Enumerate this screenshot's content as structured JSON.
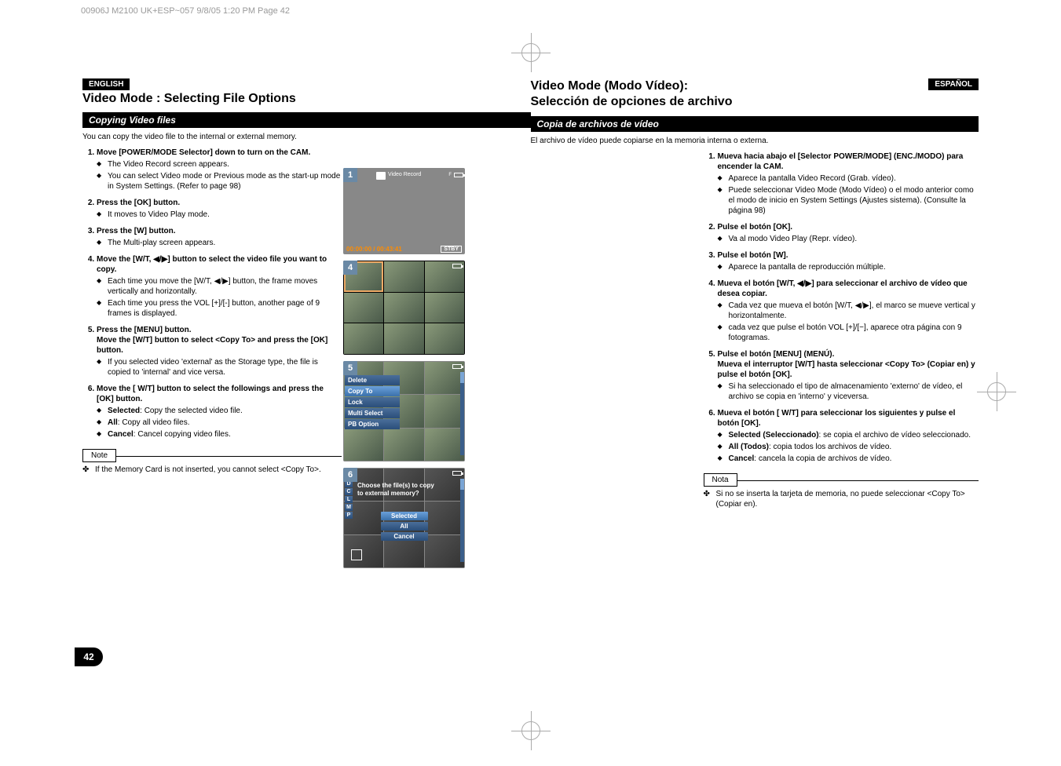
{
  "header_line": "00906J M2100 UK+ESP~057  9/8/05 1:20 PM  Page 42",
  "page_number": "42",
  "left": {
    "lang": "ENGLISH",
    "title": "Video Mode : Selecting File Options",
    "subhead": "Copying Video files",
    "intro": "You can copy the video file to the internal or external memory.",
    "steps": [
      {
        "head": "Move [POWER/MODE Selector] down to turn on the CAM.",
        "bullets": [
          "The Video Record screen appears.",
          "You can select Video mode or Previous mode as the start-up mode in System Settings. (Refer to page 98)"
        ]
      },
      {
        "head": "Press the [OK] button.",
        "bullets": [
          "It moves to Video Play mode."
        ]
      },
      {
        "head": "Press the [W] button.",
        "bullets": [
          "The Multi-play screen appears."
        ]
      },
      {
        "head": "Move the [W/T, ◀/▶] button to select the video file you want to copy.",
        "bullets": [
          "Each time you move the [W/T, ◀/▶] button, the frame moves vertically and horizontally.",
          "Each time you press the VOL [+]/[-] button, another page of 9 frames is displayed."
        ]
      },
      {
        "head": "Press the [MENU] button.\nMove the [W/T] button to select <Copy To> and press the [OK] button.",
        "bullets": [
          "If you selected video 'external' as the Storage type, the file is copied to 'internal' and vice versa."
        ]
      },
      {
        "head": "Move the [ W/T] button to select the followings and press the [OK] button.",
        "bullets_bold": [
          {
            "b": "Selected",
            "t": ": Copy the selected video file."
          },
          {
            "b": "All",
            "t": ": Copy all video files."
          },
          {
            "b": "Cancel",
            "t": ": Cancel copying video files."
          }
        ]
      }
    ],
    "note_label": "Note",
    "note_text": "If the Memory Card is not inserted, you cannot select <Copy To>."
  },
  "right": {
    "lang": "ESPAÑOL",
    "title_l1": "Video Mode (Modo Vídeo):",
    "title_l2": "Selección de opciones de archivo",
    "subhead": "Copia de archivos de vídeo",
    "intro": "El archivo de vídeo puede copiarse en la memoria interna o externa.",
    "steps": [
      {
        "head": "Mueva hacia abajo el [Selector POWER/MODE] (ENC./MODO) para encender la CAM.",
        "bullets": [
          "Aparece la pantalla Video Record (Grab. vídeo).",
          "Puede seleccionar Video Mode (Modo Vídeo) o el modo anterior como el modo de inicio en System Settings (Ajustes sistema). (Consulte la página 98)"
        ]
      },
      {
        "head": "Pulse el botón [OK].",
        "bullets": [
          "Va al modo Video Play (Repr. vídeo)."
        ]
      },
      {
        "head": "Pulse el botón [W].",
        "bullets": [
          "Aparece la pantalla de reproducción múltiple."
        ]
      },
      {
        "head": "Mueva el botón [W/T, ◀/▶] para seleccionar el archivo de vídeo que desea copiar.",
        "bullets": [
          "Cada vez que mueva el botón [W/T, ◀/▶], el marco se mueve vertical y horizontalmente.",
          "cada vez que pulse el botón VOL [+]/[−], aparece otra página con 9 fotogramas."
        ]
      },
      {
        "head": "Pulse el botón [MENU] (MENÚ).\nMueva el interruptor [W/T] hasta seleccionar <Copy To> (Copiar en) y pulse el botón [OK].",
        "bullets": [
          "Si ha seleccionado el tipo de almacenamiento 'externo' de vídeo, el archivo se copia en 'interno' y viceversa."
        ]
      },
      {
        "head": "Mueva el botón [ W/T] para seleccionar los siguientes y pulse el botón [OK].",
        "bullets_bold": [
          {
            "b": "Selected (Seleccionado)",
            "t": ": se copia el archivo de vídeo seleccionado."
          },
          {
            "b": "All (Todos)",
            "t": ": copia todos los archivos de vídeo."
          },
          {
            "b": "Cancel",
            "t": ": cancela la copia de archivos de vídeo."
          }
        ]
      }
    ],
    "note_label": "Nota",
    "note_text": "Si no se inserta la tarjeta de memoria, no puede seleccionar <Copy To> (Copiar en)."
  },
  "panels": {
    "p1": {
      "num": "1",
      "top_left": "Video Record",
      "timer": "00:00:00 / 00:43:41",
      "stby": "STBY"
    },
    "p4": {
      "num": "4"
    },
    "p5": {
      "num": "5",
      "menu": [
        "Delete",
        "Copy To",
        "Lock",
        "Multi Select",
        "PB Option"
      ],
      "highlight_index": 1
    },
    "p6": {
      "num": "6",
      "side": [
        "D",
        "C",
        "L",
        "M",
        "P"
      ],
      "msg_l1": "Choose the file(s) to copy",
      "msg_l2": "to external memory?",
      "opts": [
        "Selected",
        "All",
        "Cancel"
      ],
      "highlight_index": 0
    }
  }
}
